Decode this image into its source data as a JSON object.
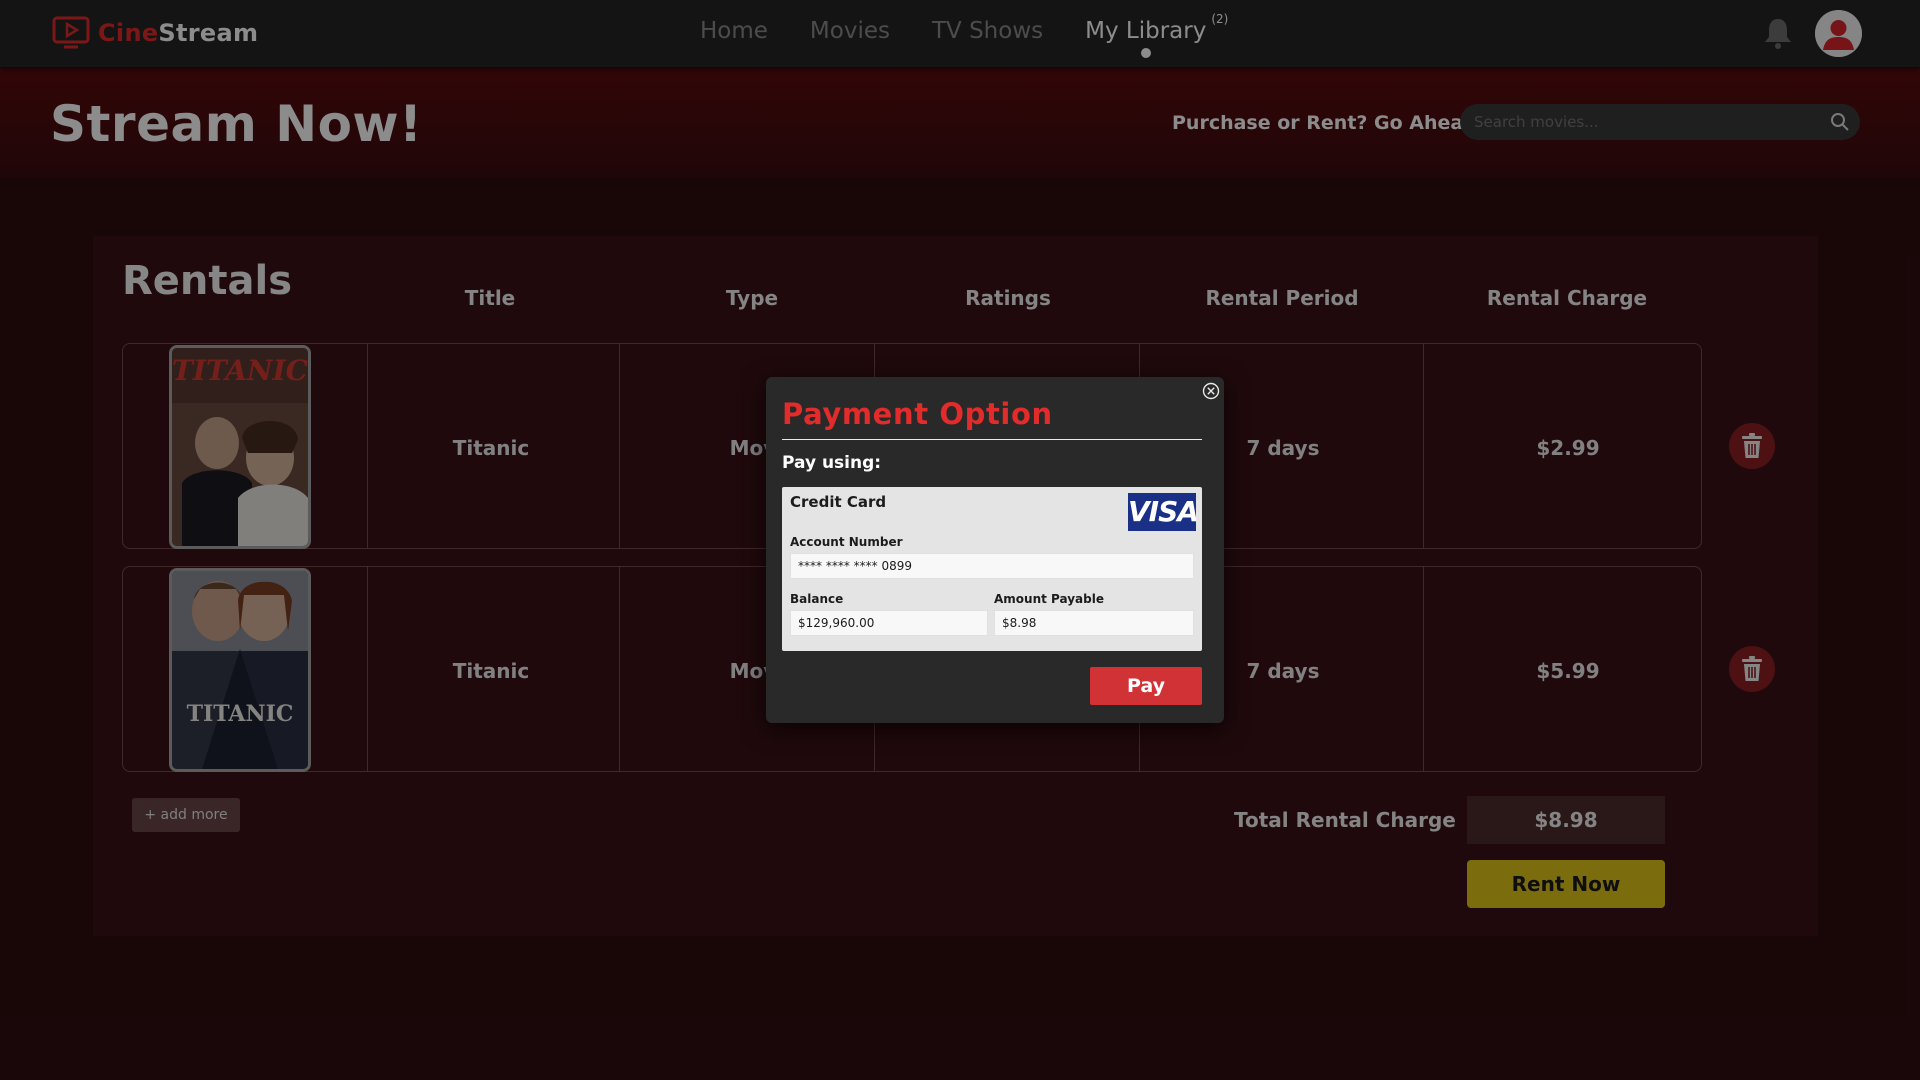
{
  "header": {
    "brand_first": "Cine",
    "brand_second": "Stream",
    "nav": [
      {
        "label": "Home"
      },
      {
        "label": "Movies"
      },
      {
        "label": "TV Shows"
      },
      {
        "label": "My Library",
        "badge": "(2)",
        "active": true
      }
    ]
  },
  "hero": {
    "title": "Stream Now!",
    "tagline": "Purchase or Rent? Go Ahead.",
    "search_placeholder": "Search movies..."
  },
  "rentals": {
    "title": "Rentals",
    "columns": [
      "Title",
      "Type",
      "Ratings",
      "Rental Period",
      "Rental Charge"
    ],
    "items": [
      {
        "title": "Titanic",
        "type": "Mov",
        "rating": "",
        "period": "7 days",
        "charge": "$2.99",
        "poster_text": "TITANIC"
      },
      {
        "title": "Titanic",
        "type": "Mov",
        "rating": "",
        "period": "7 days",
        "charge": "$5.99",
        "poster_text": "TITANIC"
      }
    ],
    "add_more": "+ add more",
    "total_label": "Total Rental Charge",
    "total_value": "$8.98",
    "rent_now": "Rent Now"
  },
  "modal": {
    "title": "Payment Option",
    "pay_using": "Pay using:",
    "card_type": "Credit Card",
    "card_brand": "VISA",
    "account_label": "Account Number",
    "account_value": "**** **** **** 0899",
    "balance_label": "Balance",
    "balance_value": "$129,960.00",
    "payable_label": "Amount Payable",
    "payable_value": "$8.98",
    "pay_button": "Pay"
  },
  "colors": {
    "brand_red": "#e12b2b",
    "accent_yellow": "#e1c51b",
    "pay_red": "#d13236",
    "visa_blue": "#1a2f86"
  }
}
